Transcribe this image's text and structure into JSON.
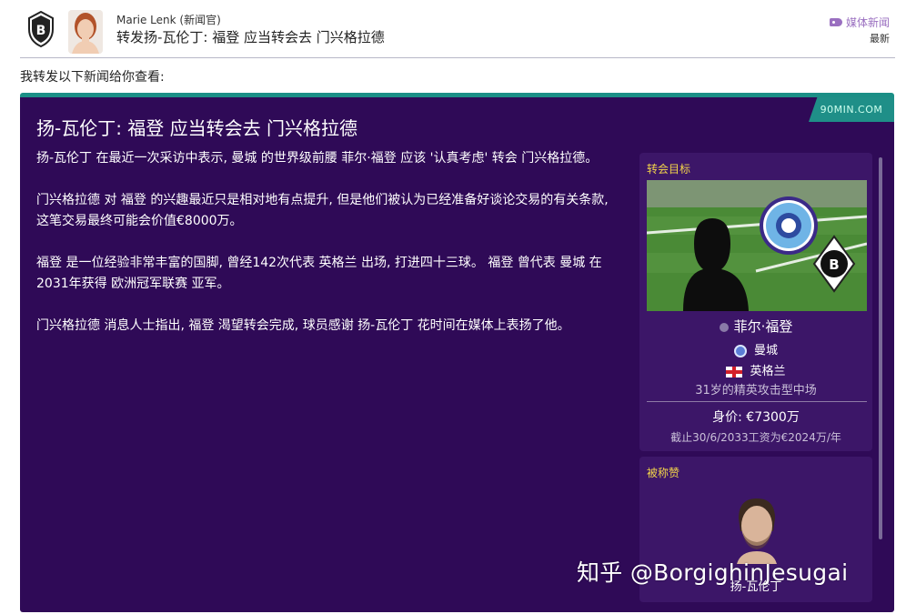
{
  "header": {
    "sender": "Marie Lenk (新闻官)",
    "subject": "转发扬-瓦伦丁: 福登 应当转会去 门兴格拉德",
    "media_label": "媒体新闻",
    "latest_label": "最新",
    "club_badge_icon": "borussia-mgladbach-badge-icon",
    "sender_avatar_icon": "news-officer-avatar-icon"
  },
  "forward_note": "我转发以下新闻给你查看:",
  "article": {
    "source": "90MIN.COM",
    "title": "扬-瓦伦丁: 福登 应当转会去 门兴格拉德",
    "paragraphs": [
      "扬-瓦伦丁 在最近一次采访中表示, 曼城 的世界级前腰 菲尔·福登 应该 '认真考虑' 转会 门兴格拉德。",
      "门兴格拉德 对 福登 的兴趣最近只是相对地有点提升, 但是他们被认为已经准备好谈论交易的有关条款, 这笔交易最终可能会价值€8000万。",
      "福登 是一位经验非常丰富的国脚, 曾经142次代表 英格兰 出场, 打进四十三球。 福登 曾代表 曼城 在2031年获得 欧洲冠军联赛 亚军。",
      "门兴格拉德 消息人士指出, 福登 渴望转会完成, 球员感谢 扬-瓦伦丁 花时间在媒体上表扬了他。"
    ]
  },
  "transfer_target": {
    "label": "转会目标",
    "player_name": "菲尔·福登",
    "club": "曼城",
    "nation": "英格兰",
    "role": "31岁的精英攻击型中场",
    "value": "身价: €7300万",
    "wage": "截止30/6/2033工资为€2024万/年"
  },
  "praised": {
    "label": "被称赞",
    "name": "扬-瓦伦丁"
  },
  "watermark": "知乎 @BorgighinJesugai",
  "colors": {
    "panel_bg": "#2f0a57",
    "card_bg": "#3c1668",
    "accent_teal": "#1f8f88",
    "label_yellow": "#f3d54a",
    "media_purple": "#9a6fc0"
  }
}
